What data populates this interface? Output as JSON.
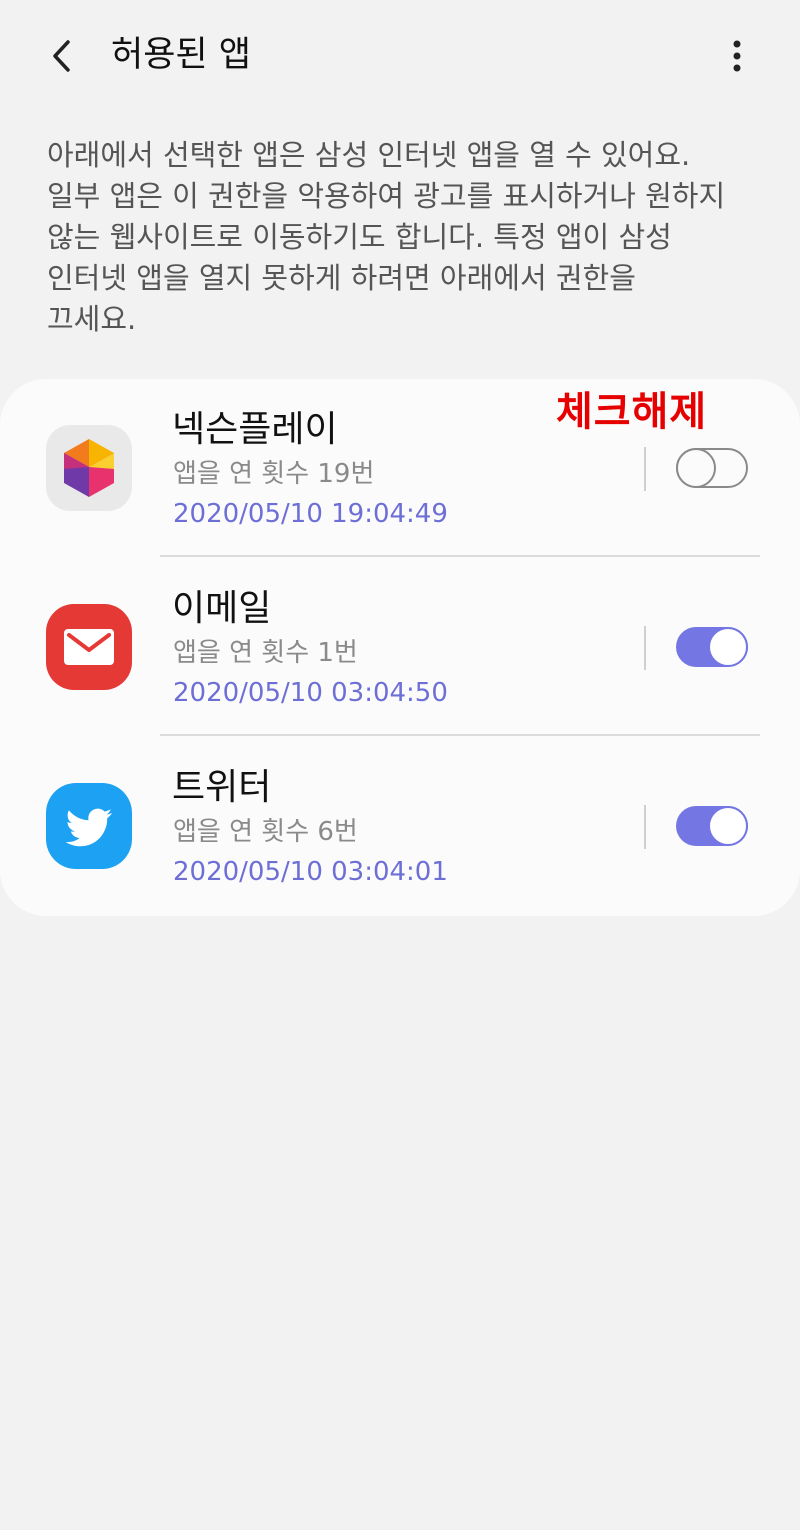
{
  "header": {
    "title": "허용된 앱",
    "back_icon": "chevron-left-icon",
    "more_icon": "more-vertical-icon"
  },
  "description": "아래에서 선택한 앱은 삼성 인터넷 앱을 열 수 있어요. 일부 앱은 이 권한을 악용하여 광고를 표시하거나 원하지 않는 웹사이트로 이동하기도 합니다. 특정 앱이 삼성 인터넷 앱을 열지 못하게 하려면 아래에서 권한을 끄세요.",
  "annotation": "체크해제",
  "apps": [
    {
      "name": "넥슨플레이",
      "count": "앱을 연 횟수 19번",
      "time": "2020/05/10 19:04:49",
      "enabled": false,
      "icon": "nexon-play-icon"
    },
    {
      "name": "이메일",
      "count": "앱을 연 횟수 1번",
      "time": "2020/05/10 03:04:50",
      "enabled": true,
      "icon": "email-icon"
    },
    {
      "name": "트위터",
      "count": "앱을 연 횟수 6번",
      "time": "2020/05/10 03:04:01",
      "enabled": true,
      "icon": "twitter-icon"
    }
  ],
  "colors": {
    "accent": "#7376e3",
    "background": "#f2f2f2",
    "card": "#fbfbfb",
    "annotation": "#e60000",
    "email_icon": "#e53935",
    "twitter_icon": "#1da1f2"
  }
}
